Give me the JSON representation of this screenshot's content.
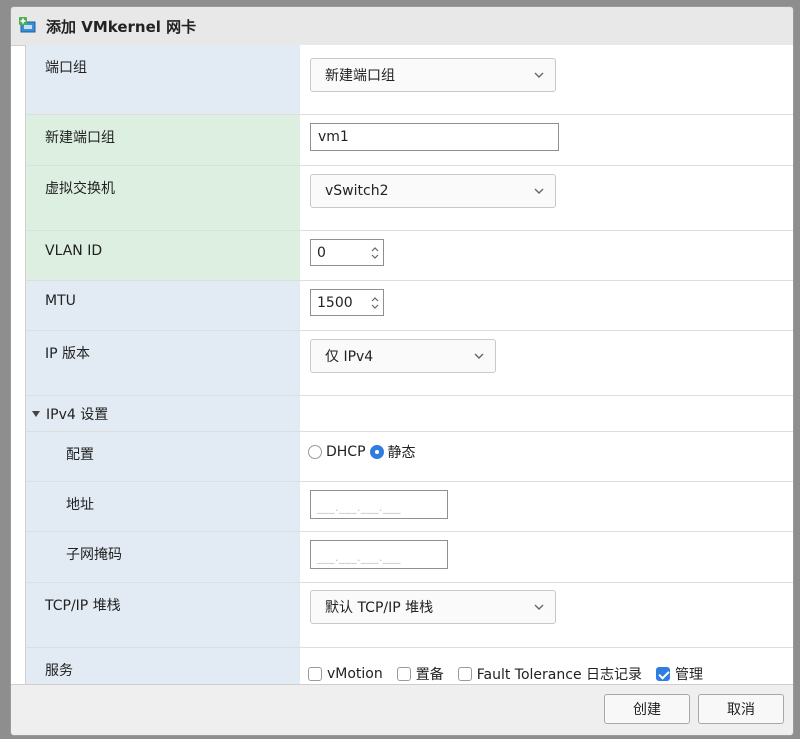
{
  "dialog": {
    "title": "添加 VMkernel 网卡",
    "icon": "add-network-icon"
  },
  "form": {
    "port_group": {
      "label": "端口组",
      "value": "新建端口组"
    },
    "new_port_group": {
      "label": "新建端口组",
      "value": "vm1"
    },
    "virtual_switch": {
      "label": "虚拟交换机",
      "value": "vSwitch2"
    },
    "vlan_id": {
      "label": "VLAN ID",
      "value": "0"
    },
    "mtu": {
      "label": "MTU",
      "value": "1500"
    },
    "ip_version": {
      "label": "IP 版本",
      "value": "仅 IPv4"
    },
    "ipv4_section": {
      "label": "IPv4 设置"
    },
    "config": {
      "label": "配置",
      "option_dhcp": "DHCP",
      "option_static": "静态",
      "selected": "静态"
    },
    "address": {
      "label": "地址",
      "placeholder": "___.___.___.___"
    },
    "subnet_mask": {
      "label": "子网掩码",
      "placeholder": "___.___.___.___"
    },
    "tcpip_stack": {
      "label": "TCP/IP 堆栈",
      "value": "默认 TCP/IP 堆栈"
    },
    "services": {
      "label": "服务",
      "items": [
        {
          "label": "vMotion",
          "checked": false
        },
        {
          "label": "置备",
          "checked": false
        },
        {
          "label": "Fault Tolerance 日志记录",
          "checked": false
        },
        {
          "label": "管理",
          "checked": true
        }
      ]
    }
  },
  "footer": {
    "create_label": "创建",
    "cancel_label": "取消"
  },
  "colors": {
    "accent": "#2f7de1",
    "label_bg": "#e2ebf4",
    "required_label_bg": "#dcefe0"
  }
}
